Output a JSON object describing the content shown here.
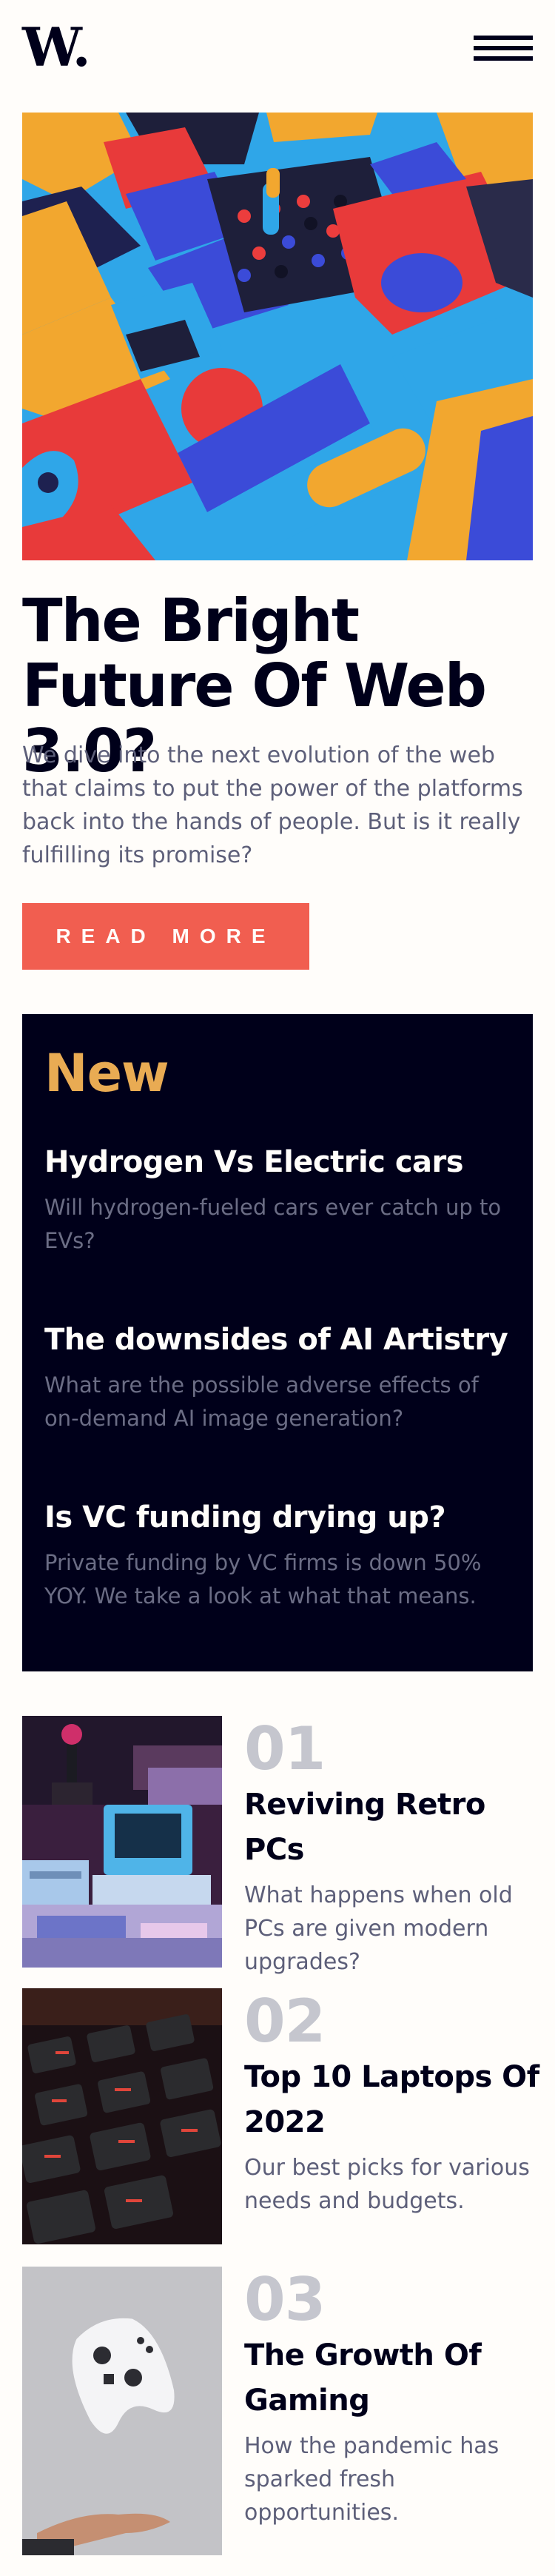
{
  "header": {
    "logo": "W.",
    "menu_icon": "hamburger-menu-icon"
  },
  "hero": {
    "image_alt": "colorful 3d geometric blocks",
    "title": "The Bright Future Of Web 3.0?",
    "description": "We dive into the next evolution of the web that claims to put the power of the platforms back into the hands of people. But is it really fulfilling its promise?",
    "button_label": "Read more"
  },
  "new_section": {
    "heading": "New",
    "items": [
      {
        "title": "Hydrogen Vs Electric cars",
        "description": "Will hydrogen-fueled cars ever catch up to EVs?"
      },
      {
        "title": "The downsides of AI Artistry",
        "description": "What are the possible adverse effects of on-demand AI image generation?"
      },
      {
        "title": "Is VC funding drying up?",
        "description": "Private funding by VC firms is down 50% YOY. We take a look at what that means."
      }
    ]
  },
  "articles": [
    {
      "number": "01",
      "title": "Reviving Retro PCs",
      "description": "What happens when old PCs are given modern upgrades?"
    },
    {
      "number": "02",
      "title": "Top 10 Laptops Of 2022",
      "description": "Our best picks for various needs and budgets."
    },
    {
      "number": "03",
      "title": "The Growth Of Gaming",
      "description": "How the pandemic has sparked fresh opportunities."
    }
  ],
  "colors": {
    "background": "#fffdfa",
    "dark": "#00001a",
    "accent_red": "#f15e50",
    "accent_gold": "#e9ab53",
    "muted_text": "#5d5f79",
    "number_grey": "#c5c6ce"
  }
}
